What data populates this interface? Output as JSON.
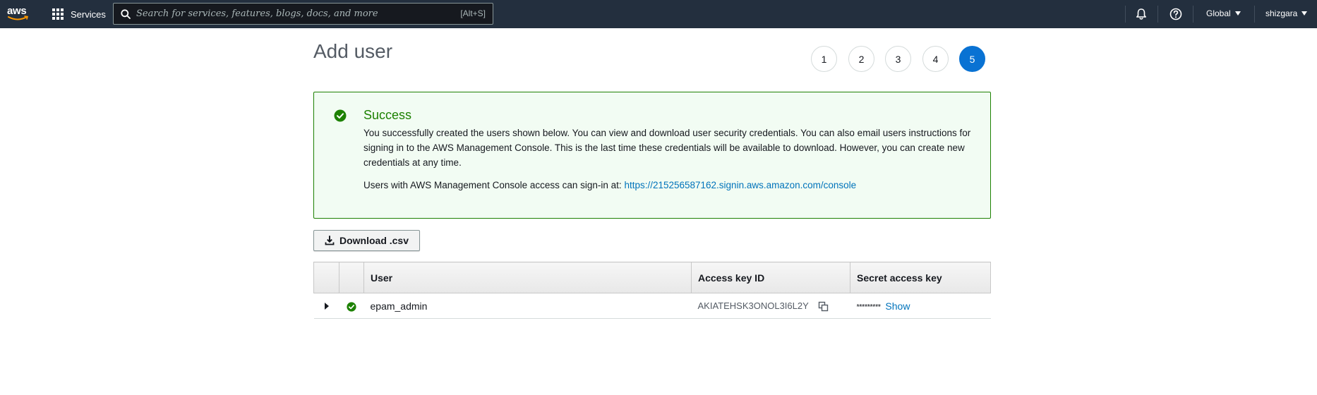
{
  "nav": {
    "logo_text": "aws",
    "services_label": "Services",
    "search_placeholder": "Search for services, features, blogs, docs, and more",
    "search_shortcut": "[Alt+S]",
    "region_label": "Global",
    "account_label": "shizgara"
  },
  "page": {
    "title": "Add user",
    "steps": [
      "1",
      "2",
      "3",
      "4",
      "5"
    ],
    "active_step": 5
  },
  "success": {
    "title": "Success",
    "message": "You successfully created the users shown below. You can view and download user security credentials. You can also email users instructions for signing in to the AWS Management Console. This is the last time these credentials will be available to download. However, you can create new credentials at any time.",
    "signin_prefix": "Users with AWS Management Console access can sign-in at:",
    "signin_url": "https://215256587162.signin.aws.amazon.com/console"
  },
  "download_button": "Download .csv",
  "table": {
    "headers": {
      "user": "User",
      "access_key": "Access key ID",
      "secret_key": "Secret access key"
    },
    "rows": [
      {
        "user": "epam_admin",
        "access_key_id": "AKIATEHSK3ONOL3I6L2Y",
        "secret_mask": "*********",
        "show_label": "Show"
      }
    ]
  },
  "colors": {
    "nav_bg": "#232f3e",
    "success_green": "#1d8102",
    "success_bg": "#f2fcf3",
    "link_blue": "#0073bb",
    "active_step": "#0972d3"
  }
}
